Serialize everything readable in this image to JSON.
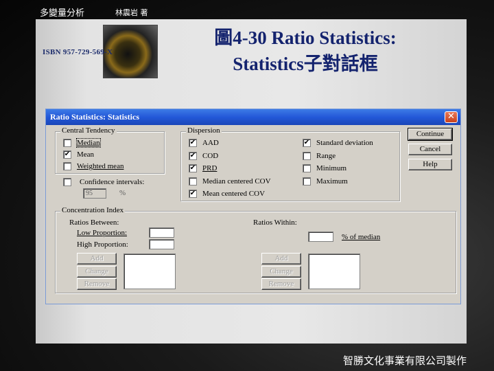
{
  "slide": {
    "header_left": "多變量分析",
    "header_author": "林震岩 著",
    "isbn": "ISBN 957-729-569-X",
    "title_line1": "圖4-30  Ratio Statistics:",
    "title_line2": "Statistics子對話框",
    "footer": "智勝文化事業有限公司製作"
  },
  "dialog": {
    "title": "Ratio Statistics: Statistics",
    "close_glyph": "✕",
    "central_tendency": {
      "legend": "Central Tendency",
      "items": [
        {
          "label": "Median",
          "checked": false
        },
        {
          "label": "Mean",
          "checked": true
        },
        {
          "label": "Weighted mean",
          "checked": false
        }
      ],
      "confidence_label": "Confidence intervals:",
      "confidence_checked": false,
      "confidence_value": "95",
      "percent": "%"
    },
    "dispersion": {
      "legend": "Dispersion",
      "left_items": [
        {
          "label": "AAD",
          "checked": true
        },
        {
          "label": "COD",
          "checked": true
        },
        {
          "label": "PRD",
          "checked": true
        },
        {
          "label": "Median centered COV",
          "checked": false
        },
        {
          "label": "Mean centered COV",
          "checked": true
        }
      ],
      "right_items": [
        {
          "label": "Standard deviation",
          "checked": true
        },
        {
          "label": "Range",
          "checked": false
        },
        {
          "label": "Minimum",
          "checked": false
        },
        {
          "label": "Maximum",
          "checked": false
        }
      ]
    },
    "buttons": {
      "continue": "Continue",
      "cancel": "Cancel",
      "help": "Help"
    },
    "concentration": {
      "legend": "Concentration Index",
      "ratios_between": "Ratios Between:",
      "low_proportion": "Low Proportion:",
      "high_proportion": "High Proportion:",
      "ratios_within": "Ratios Within:",
      "pct_of_median": "% of median",
      "add": "Add",
      "change": "Change",
      "remove": "Remove"
    }
  },
  "check_glyph": "✔"
}
